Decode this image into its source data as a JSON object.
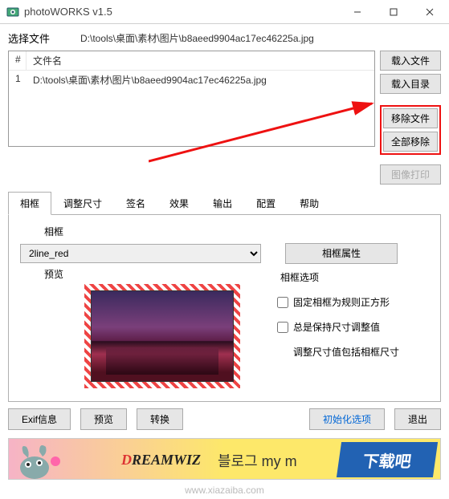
{
  "window": {
    "title": "photoWORKS v1.5"
  },
  "pathrow": {
    "label": "选择文件",
    "value": "D:\\tools\\桌面\\素材\\图片\\b8aeed9904ac17ec46225a.jpg"
  },
  "table": {
    "col_index": "#",
    "col_name": "文件名",
    "rows": [
      {
        "n": "1",
        "name": "D:\\tools\\桌面\\素材\\图片\\b8aeed9904ac17ec46225a.jpg"
      }
    ]
  },
  "sidebuttons": {
    "load_file": "载入文件",
    "load_dir": "载入目录",
    "remove_file": "移除文件",
    "remove_all": "全部移除",
    "print": "图像打印"
  },
  "tabs": {
    "frame": "相框",
    "resize": "调整尺寸",
    "sign": "签名",
    "effect": "效果",
    "output": "输出",
    "config": "配置",
    "help": "帮助"
  },
  "frametab": {
    "section_label": "相框",
    "select_value": "2line_red",
    "properties_btn": "相框属性",
    "preview_label": "预览",
    "options_header": "相框选项",
    "chk_fixed": "固定相框为规则正方形",
    "chk_keep": "总是保持尺寸调整值",
    "indent_text": "调整尺寸值包括相框尺寸"
  },
  "bottom": {
    "exif": "Exif信息",
    "preview": "预览",
    "convert": "转换",
    "init": "初始化选项",
    "exit": "退出"
  },
  "banner": {
    "logo1_pre": "D",
    "logo1_rest": "REAMWIZ",
    "logo2": "블로그 my m",
    "stamp": "下载吧"
  },
  "watermark": "www.xiazaiba.com"
}
